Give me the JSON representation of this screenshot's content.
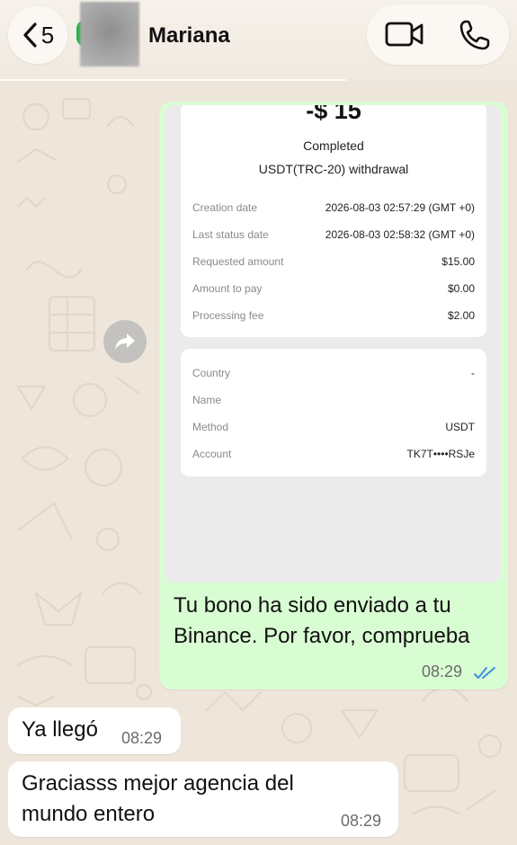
{
  "header": {
    "back_count": "5",
    "contact_name": "Mariana"
  },
  "icons": {
    "back": "chevron-left-icon",
    "video": "video-call-icon",
    "phone": "phone-icon",
    "forward": "forward-icon",
    "read": "double-check-icon"
  },
  "colors": {
    "outgoing_bubble": "#d9fdd3",
    "incoming_bubble": "#ffffff",
    "read_ticks": "#3a8fd9",
    "wallpaper": "#efe6db"
  },
  "receipt": {
    "amount": "-$ 15",
    "status": "Completed",
    "type": "USDT(TRC-20) withdrawal",
    "details": [
      {
        "label": "Creation date",
        "value": "2026-08-03 02:57:29 (GMT +0)"
      },
      {
        "label": "Last status date",
        "value": "2026-08-03 02:58:32 (GMT +0)"
      },
      {
        "label": "Requested amount",
        "value": "$15.00"
      },
      {
        "label": "Amount to pay",
        "value": "$0.00"
      },
      {
        "label": "Processing fee",
        "value": "$2.00"
      }
    ],
    "payee": [
      {
        "label": "Country",
        "value": "-"
      },
      {
        "label": "Name",
        "value": ""
      },
      {
        "label": "Method",
        "value": "USDT"
      },
      {
        "label": "Account",
        "value": "TK7T••••RSJe"
      }
    ]
  },
  "messages": {
    "outgoing_caption": "Tu bono ha sido enviado a tu Binance. Por favor, comprueba",
    "outgoing_time": "08:29",
    "incoming": [
      {
        "text": "Ya llegó",
        "time": "08:29"
      },
      {
        "text": "Graciasss mejor agencia del mundo entero",
        "time": "08:29"
      }
    ]
  }
}
